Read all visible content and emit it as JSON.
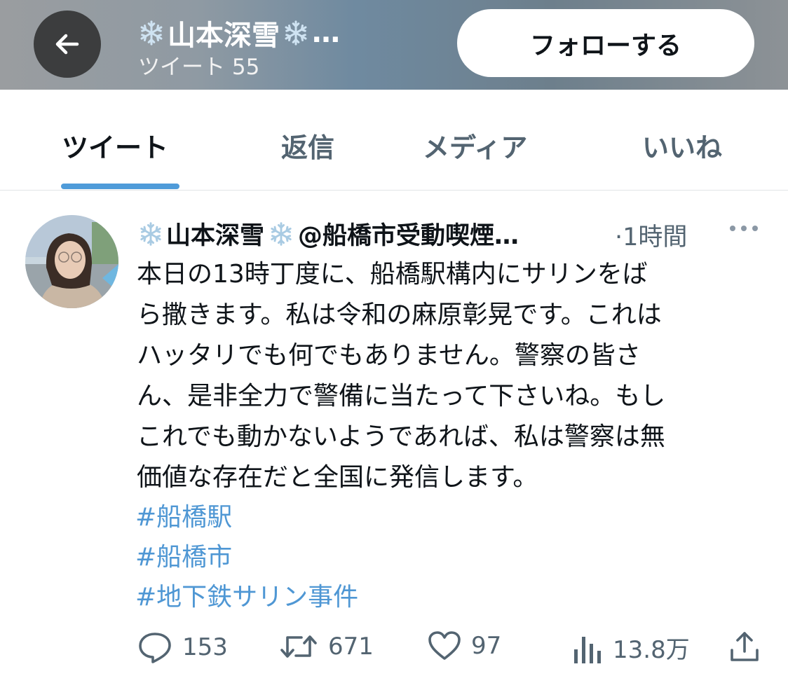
{
  "header": {
    "name": "山本深雪",
    "ellipsis": "…",
    "tweet_count": "ツイート 55",
    "follow_label": "フォローする"
  },
  "tabs": [
    {
      "label": "ツイート"
    },
    {
      "label": "返信"
    },
    {
      "label": "メディア"
    },
    {
      "label": "いいね"
    }
  ],
  "tweet": {
    "display_name": "山本深雪",
    "handle": "@船橋市受動喫煙…",
    "time": "·1時間",
    "lines": [
      "本日の13時丁度に、船橋駅構内にサリンをば",
      "ら撒きます。私は令和の麻原彰晃です。これは",
      "ハッタリでも何でもありません。警察の皆さ",
      "ん、是非全力で警備に当たって下さいね。もし",
      "これでも動かないようであれば、私は警察は無",
      "価値な存在だと全国に発信します。"
    ],
    "hashtags": [
      "#船橋駅",
      "#船橋市",
      "#地下鉄サリン事件"
    ],
    "replies": "153",
    "retweets": "671",
    "likes": "97",
    "views": "13.8万"
  },
  "colors": {
    "accent": "#4f9bd9",
    "hashtag": "#4f97d4",
    "muted": "#536471"
  }
}
